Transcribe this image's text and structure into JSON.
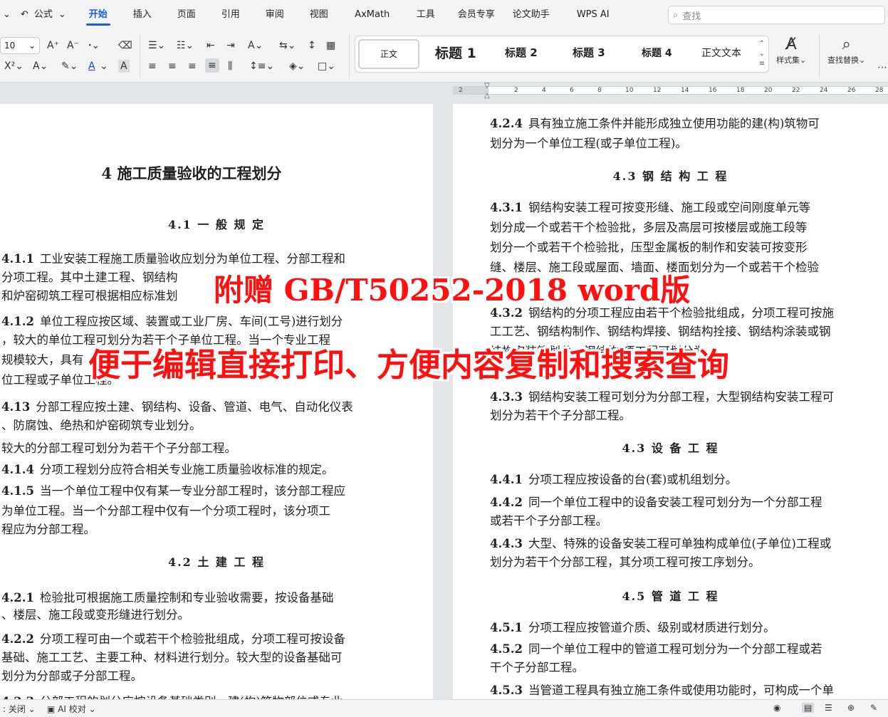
{
  "ribbon": {
    "undo_icon": "undo-icon",
    "format_painter": "公式",
    "tabs": [
      "开始",
      "插入",
      "页面",
      "引用",
      "审阅",
      "视图",
      "AxMath",
      "工具",
      "会员专享",
      "论文助手",
      "WPS AI"
    ],
    "active_tab": "开始",
    "search_placeholder": "查找"
  },
  "toolbar": {
    "font_size": "10",
    "styles": [
      "正文",
      "标题 1",
      "标题 2",
      "标题 3",
      "标题 4",
      "正文文本"
    ],
    "style_set_label": "样式集",
    "find_replace_label": "查找替换"
  },
  "ruler": {
    "labels": [
      "2",
      "2",
      "4",
      "6",
      "8",
      "10",
      "12",
      "14",
      "16",
      "18",
      "20",
      "22",
      "24",
      "26",
      "28"
    ]
  },
  "doc_left": [
    {
      "type": "h1",
      "text": "4  施工质量验收的工程划分"
    },
    {
      "type": "h2",
      "text": "4.1 一 般 规 定"
    },
    {
      "type": "p",
      "num": "4.1.1",
      "text": "工业安装工程施工质量验收应划分为单位工程、分部工程和"
    },
    {
      "type": "p",
      "text": "分项工程。其中土建工程、钢结构"
    },
    {
      "type": "p",
      "text": "和炉窑砌筑工程可根据相应标准划"
    },
    {
      "type": "p",
      "num": "4.1.2",
      "text": "单位工程应按区域、装置或工业厂房、车间(工号)进行划分"
    },
    {
      "type": "p",
      "text": "，较大的单位工程可划分为若干个子单位工程。当一个专业工程"
    },
    {
      "type": "p",
      "text": "规模较大，具有"
    },
    {
      "type": "p",
      "text": "位工程或子单位工程。"
    },
    {
      "type": "p",
      "num": "4.13",
      "text": "分部工程应按土建、钢结构、设备、管道、电气、自动化仪表"
    },
    {
      "type": "p",
      "text": "、防腐蚀、绝热和炉窑砌筑专业划分。"
    },
    {
      "type": "p",
      "text": "    较大的分部工程可划分为若干个子分部工程。"
    },
    {
      "type": "p",
      "num": "4.1.4",
      "text": "分项工程划分应符合相关专业施工质量验收标准的规定。"
    },
    {
      "type": "p",
      "num": "4.1.5",
      "text": "当一个单位工程中仅有某一专业分部工程时，该分部工程应"
    },
    {
      "type": "p",
      "text": "为单位工程。当一个分部工程中仅有一个分项工程时，该分项工"
    },
    {
      "type": "p",
      "text": "程应为分部工程。"
    },
    {
      "type": "h2",
      "text": "4.2 土  建  工  程"
    },
    {
      "type": "p",
      "num": "4.2.1",
      "text": "检验批可根据施工质量控制和专业验收需要，按设备基础"
    },
    {
      "type": "p",
      "text": "、楼层、施工段或变形缝进行划分。"
    },
    {
      "type": "p",
      "num": "4.2.2",
      "text": "分项工程可由一个或若干个检验批组成，分项工程可按设备"
    },
    {
      "type": "p",
      "text": "基础、施工工艺、主要工种、材料进行划分。较大型的设备基础可"
    },
    {
      "type": "p",
      "text": "划分为分部或子分部工程。"
    },
    {
      "type": "p",
      "num": "4.2.3",
      "text": "分部工程的划分应按设备基础类别、建(构)筑物部位或专业"
    }
  ],
  "doc_right": [
    {
      "type": "p",
      "num": "4.2.4",
      "text": "具有独立施工条件并能形成独立使用功能的建(构)筑物可"
    },
    {
      "type": "p",
      "text": "划分为一个单位工程(或子单位工程)。"
    },
    {
      "type": "h2",
      "text": "4.3 钢 结 构 工 程"
    },
    {
      "type": "p",
      "num": "4.3.1",
      "text": "钢结构安装工程可按变形缝、施工段或空间刚度单元等"
    },
    {
      "type": "p",
      "text": "划分成一个或若干个检验批，多层及高层可按楼层或施工段等"
    },
    {
      "type": "p",
      "text": "划分一个或若干个检验批，压型金属板的制作和安装可按变形"
    },
    {
      "type": "p",
      "text": "缝、楼层、施工段或屋面、墙面、楼面划分为一个或若干个检验"
    },
    {
      "type": "p",
      "num": "4.3.2",
      "text": "钢结构的分项工程应由若干个检验批组成，分项工程可按施"
    },
    {
      "type": "p",
      "text": "工工艺、钢结构制作、钢结构焊接、钢结构拴接、钢结构涂装或钢"
    },
    {
      "type": "p",
      "text": "结构安装等划分。钢结构                        项工程可划分为"
    },
    {
      "type": "p",
      "num": "4.3.3",
      "text": "钢结构安装工程可划分为分部工程，大型钢结构安装工程可"
    },
    {
      "type": "p",
      "text": "划分为若干个子分部工程。"
    },
    {
      "type": "h2",
      "text": "4.3 设  备  工  程"
    },
    {
      "type": "p",
      "num": "4.4.1",
      "text": "分项工程应按设备的台(套)或机组划分。"
    },
    {
      "type": "p",
      "num": "4.4.2",
      "text": "同一个单位工程中的设备安装工程可划分为一个分部工程"
    },
    {
      "type": "p",
      "text": "或若干个子分部工程。"
    },
    {
      "type": "p",
      "num": "4.4.3",
      "text": "大型、特殊的设备安装工程可单独构成单位(子单位)工程或"
    },
    {
      "type": "p",
      "text": "划分为若干个分部工程，其分项工程可按工序划分。"
    },
    {
      "type": "h2",
      "text": "4.5 管  道  工  程"
    },
    {
      "type": "p",
      "num": "4.5.1",
      "text": "分项工程应按管道介质、级别或材质进行划分。"
    },
    {
      "type": "p",
      "num": "4.5.2",
      "text": "同一个单位工程中的管道工程可划分为一个分部工程或若"
    },
    {
      "type": "p",
      "text": "干个子分部工程。"
    },
    {
      "type": "p",
      "num": "4.5.3",
      "text": "当管道工程具有独立施工条件或使用功能时，可构成一个单"
    }
  ],
  "overlay": {
    "line1": "附赠 GB/T50252-2018 word版",
    "line2": "便于编辑直接打印、方便内容复制和搜索查询",
    "color": "#ff1010"
  },
  "statusbar": {
    "spell_label": ": 关闭",
    "ai_check_label": "AI 校对"
  }
}
